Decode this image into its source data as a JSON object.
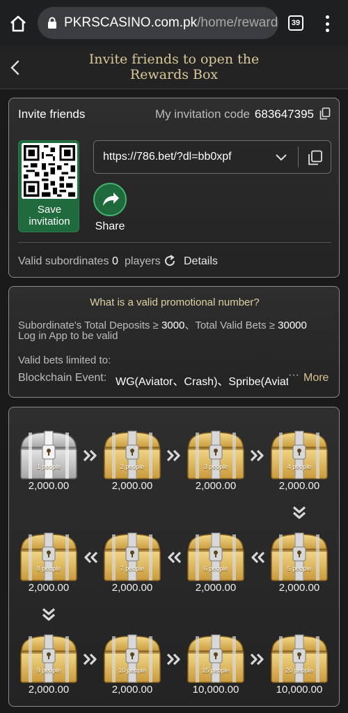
{
  "browser": {
    "domain": "PKRSCASINO.com.pk",
    "path": "/home/rewards",
    "tab_count": "39"
  },
  "header": {
    "title_line1": "Invite friends to open the",
    "title_line2": "Rewards Box"
  },
  "invite_panel": {
    "title": "Invite friends",
    "code_label": "My invitation code",
    "code_value": "683647395",
    "save_label_line1": "Save",
    "save_label_line2": "invitation",
    "link": "https://786.bet/?dl=bb0xpf",
    "share_label": "Share",
    "subordinates_label": "Valid subordinates",
    "subordinates_count": "0",
    "subordinates_unit": "players",
    "details_label": "Details"
  },
  "promo_panel": {
    "title": "What is a valid promotional number?",
    "line1_prefix": "Subordinate's Total Deposits ≥ ",
    "line1_deposit": "3000",
    "line1_middle": "、Total Valid Bets ≥ ",
    "line1_bets": "30000",
    "line2": "Log in App to be valid",
    "limited_label": "Valid bets limited to:",
    "chain_label": "Blockchain Event:",
    "chain_value": "WG(Aviator、Crash)、Spribe(Aviator、Dice、Mines)",
    "chain_ellipsis": "···",
    "more_label": "More"
  },
  "chests": [
    {
      "people": "1 people",
      "amount": "2,000.00",
      "locked": false
    },
    {
      "people": "2 people",
      "amount": "2,000.00",
      "locked": true
    },
    {
      "people": "3 people",
      "amount": "2,000.00",
      "locked": true
    },
    {
      "people": "4 people",
      "amount": "2,000.00",
      "locked": true
    },
    {
      "people": "5 people",
      "amount": "2,000.00",
      "locked": true
    },
    {
      "people": "6 people",
      "amount": "2,000.00",
      "locked": true
    },
    {
      "people": "7 people",
      "amount": "2,000.00",
      "locked": true
    },
    {
      "people": "8 people",
      "amount": "2,000.00",
      "locked": true
    },
    {
      "people": "9 people",
      "amount": "2,000.00",
      "locked": true
    },
    {
      "people": "10 people",
      "amount": "2,000.00",
      "locked": true
    },
    {
      "people": "15 people",
      "amount": "10,000.00",
      "locked": true
    },
    {
      "people": "20 people",
      "amount": "10,000.00",
      "locked": true
    }
  ],
  "colors": {
    "gold": "#d9b35a",
    "silver": "#bdbdbd",
    "green": "#1f6b3e",
    "accent_text": "#d8c48e"
  }
}
